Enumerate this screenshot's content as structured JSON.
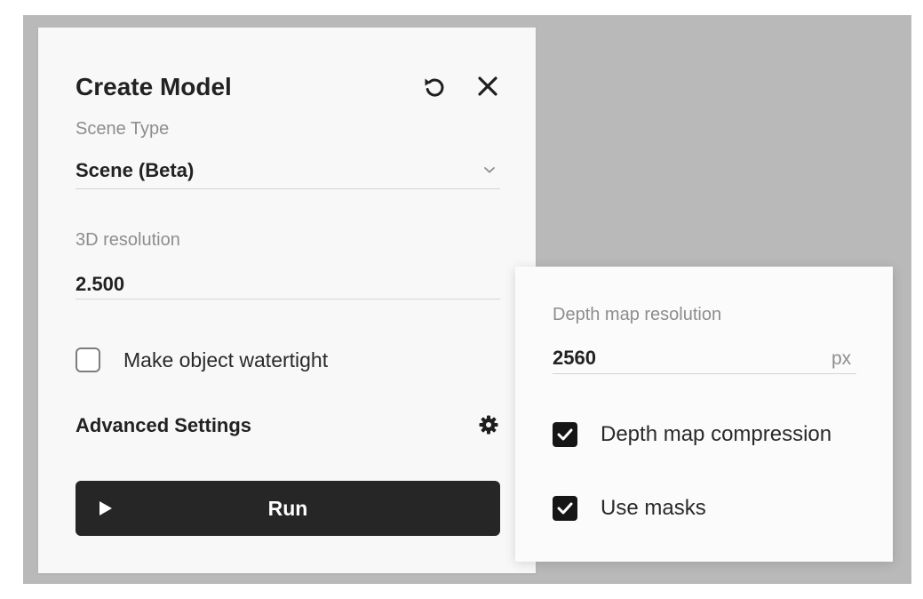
{
  "dialog": {
    "title": "Create Model",
    "scene_type": {
      "label": "Scene Type",
      "value": "Scene (Beta)"
    },
    "resolution": {
      "label": "3D resolution",
      "value": "2.500"
    },
    "watertight": {
      "label": "Make object watertight",
      "checked": false
    },
    "advanced_settings_label": "Advanced Settings",
    "run_label": "Run"
  },
  "advanced_popover": {
    "depth_map_resolution": {
      "label": "Depth map resolution",
      "value": "2560",
      "unit": "px"
    },
    "depth_map_compression": {
      "label": "Depth map compression",
      "checked": true
    },
    "use_masks": {
      "label": "Use masks",
      "checked": true
    }
  },
  "icons": {
    "reset": "reset-icon",
    "close": "close-icon",
    "chevron": "chevron-down-icon",
    "gear": "gear-icon",
    "play": "play-icon",
    "check": "check-icon"
  },
  "colors": {
    "backdrop": "#b9b9b9",
    "panel": "#f8f8f8",
    "run_button": "#262626",
    "checkbox_checked": "#161616",
    "label_gray": "#8d8d8d"
  }
}
